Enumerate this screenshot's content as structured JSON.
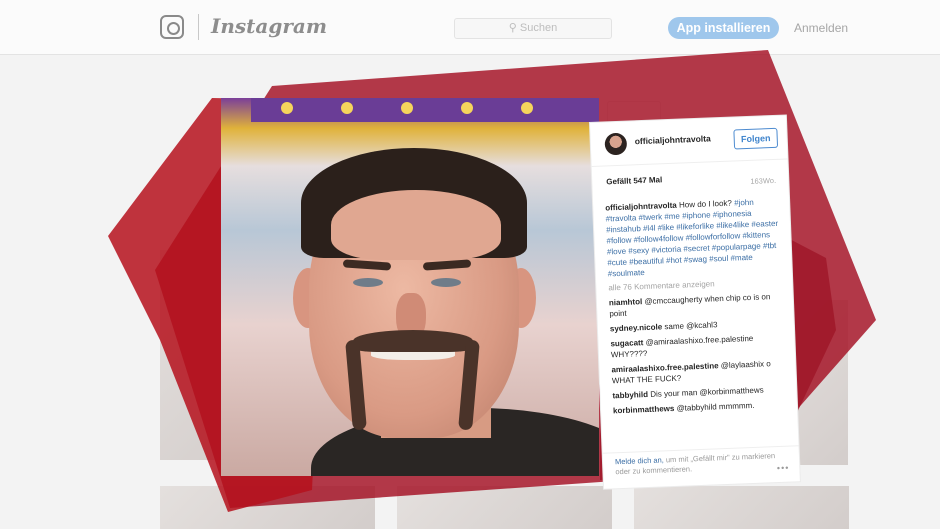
{
  "topbar": {
    "brand": "Instagram",
    "search_placeholder": "Suchen",
    "install_button": "App installieren",
    "login_link": "Anmelden"
  },
  "background": {
    "profile_name": "officialjohntravolta"
  },
  "post": {
    "username": "officialjohntravolta",
    "follow_button": "Folgen",
    "likes": "Gefällt 547 Mal",
    "age": "163Wo.",
    "caption_user": "officialjohntravolta",
    "caption_text": "How do I look?",
    "caption_tags": "#john #travolta #twerk #me #iphone #iphonesia #instahub #l4l #like #likeforlike #like4like #easter #follow #follow4follow #followforfollow #kittens #love #sexy #victoria #secret #popularpage #tbt #cute #beautiful #hot #swag #soul #mate #soulmate",
    "all_comments": "alle 76 Kommentare anzeigen",
    "comments": [
      {
        "user": "niamhtol",
        "text": "@cmccaugherty when chip co is on point"
      },
      {
        "user": "sydney.nicole",
        "text": "same @kcahl3"
      },
      {
        "user": "sugacatt",
        "text": "@amiraalashixo.free.palestine WHY????"
      },
      {
        "user": "amiraalashixo.free.palestine",
        "text": "@laylaashix o WHAT THE FUCK?"
      },
      {
        "user": "tabbyhild",
        "text": "Dis your man @korbinmatthews"
      },
      {
        "user": "korbinmatthews",
        "text": "@tabbyhild mmmmm."
      }
    ],
    "footer_login": "Melde dich an,",
    "footer_text": "um mit „Gefällt mir\" zu markieren oder zu kommentieren.",
    "more_dots": "•••"
  },
  "colors": {
    "overlay_red": "#a30f22",
    "follow_blue": "#3f84cc",
    "install_button": "#9fc7ec"
  }
}
